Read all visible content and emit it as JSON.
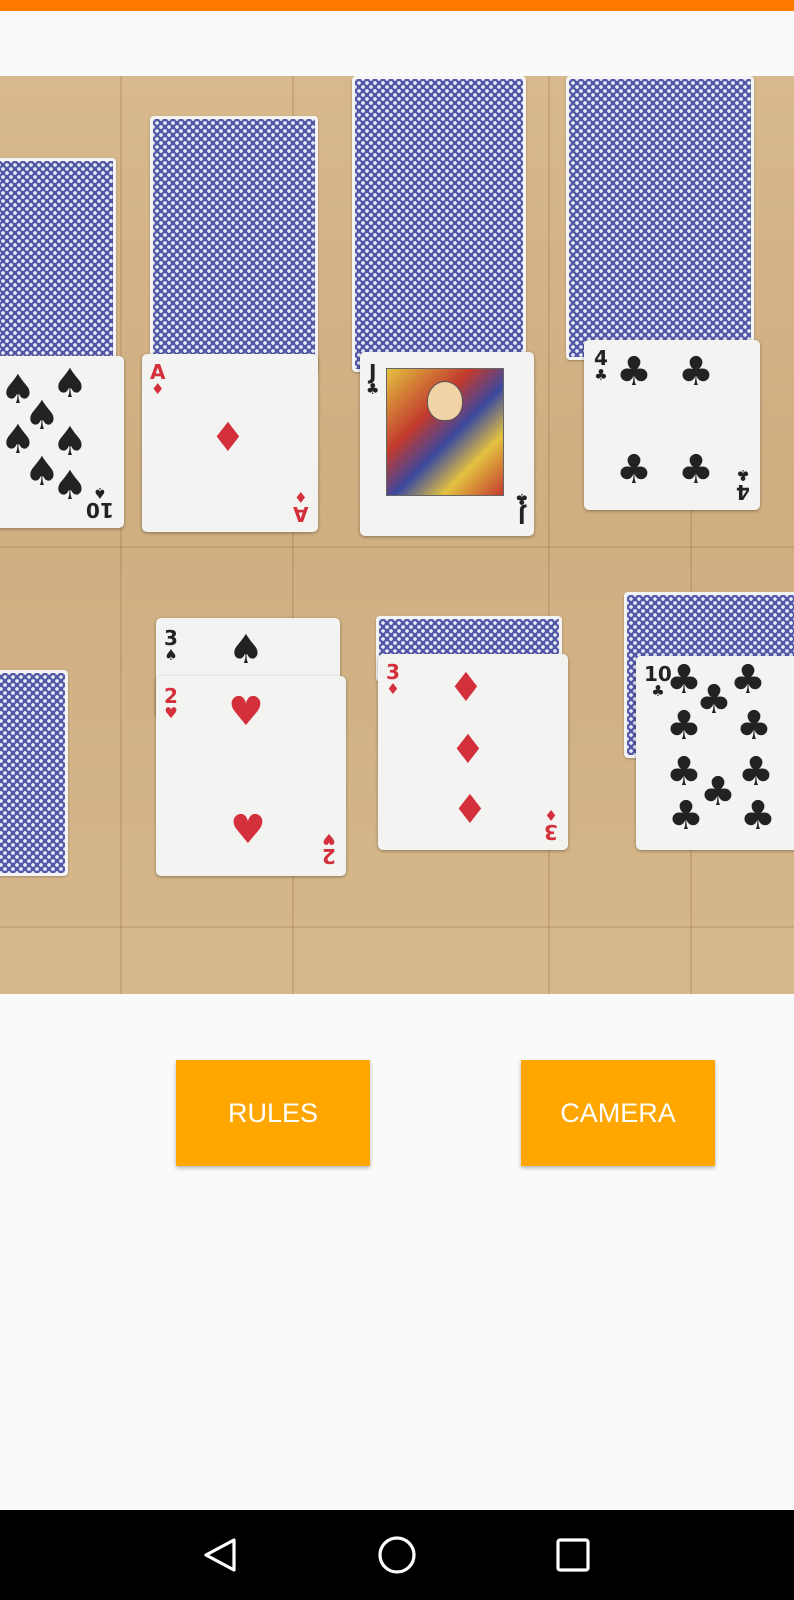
{
  "buttons": {
    "rules_label": "RULES",
    "camera_label": "CAMERA"
  },
  "colors": {
    "status_bar": "#ff7a00",
    "button_bg": "#ffa600",
    "button_text": "#ffffff",
    "nav_bar": "#000000"
  },
  "photo": {
    "cards": {
      "ten_spades": {
        "rank": "10",
        "suit": "♠"
      },
      "ace_diamonds": {
        "rank": "A",
        "suit": "♦"
      },
      "jack_clubs": {
        "rank": "J",
        "suit": "♣"
      },
      "four_clubs": {
        "rank": "4",
        "suit": "♣"
      },
      "three_spades": {
        "rank": "3",
        "suit": "♠"
      },
      "two_hearts": {
        "rank": "2",
        "suit": "♥"
      },
      "three_diamonds": {
        "rank": "3",
        "suit": "♦"
      },
      "ten_clubs": {
        "rank": "10",
        "suit": "♣"
      }
    }
  },
  "nav": {
    "back_icon": "back-triangle-icon",
    "home_icon": "home-circle-icon",
    "recents_icon": "recents-square-icon"
  }
}
